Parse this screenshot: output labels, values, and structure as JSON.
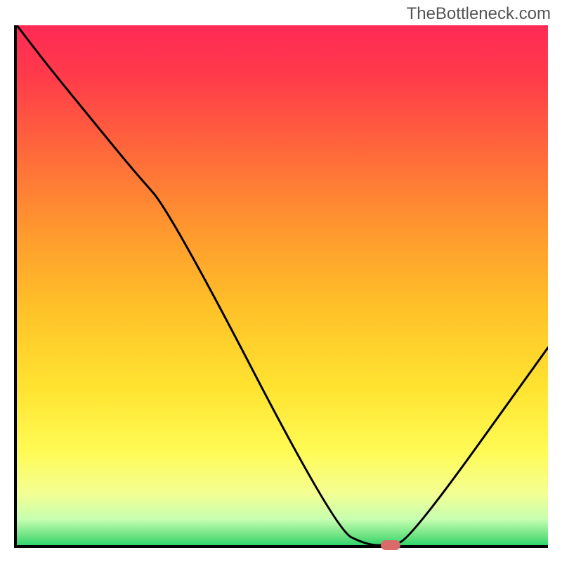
{
  "watermark": "TheBottleneck.com",
  "gradient_stops": [
    {
      "offset": 0.0,
      "color": "#ff2a55"
    },
    {
      "offset": 0.1,
      "color": "#ff3b4a"
    },
    {
      "offset": 0.25,
      "color": "#ff6b3a"
    },
    {
      "offset": 0.4,
      "color": "#ff9a2e"
    },
    {
      "offset": 0.55,
      "color": "#ffc328"
    },
    {
      "offset": 0.7,
      "color": "#ffe431"
    },
    {
      "offset": 0.82,
      "color": "#fffb55"
    },
    {
      "offset": 0.9,
      "color": "#f4ff93"
    },
    {
      "offset": 0.95,
      "color": "#c6ffb0"
    },
    {
      "offset": 0.985,
      "color": "#63e07e"
    },
    {
      "offset": 1.0,
      "color": "#2fd56e"
    }
  ],
  "chart_data": {
    "type": "line",
    "title": "",
    "xlabel": "",
    "ylabel": "",
    "xlim": [
      0,
      100
    ],
    "ylim": [
      0,
      100
    ],
    "grid": false,
    "legend": false,
    "series": [
      {
        "name": "bottleneck-curve",
        "x": [
          0,
          6,
          14,
          22,
          29,
          60,
          66,
          70,
          74,
          100
        ],
        "y": [
          100,
          92,
          82,
          72,
          64,
          3,
          0,
          0,
          1,
          38
        ]
      }
    ],
    "marker": {
      "x_pct": 70,
      "y_pct": 0.5,
      "color": "#d96a6a"
    }
  }
}
